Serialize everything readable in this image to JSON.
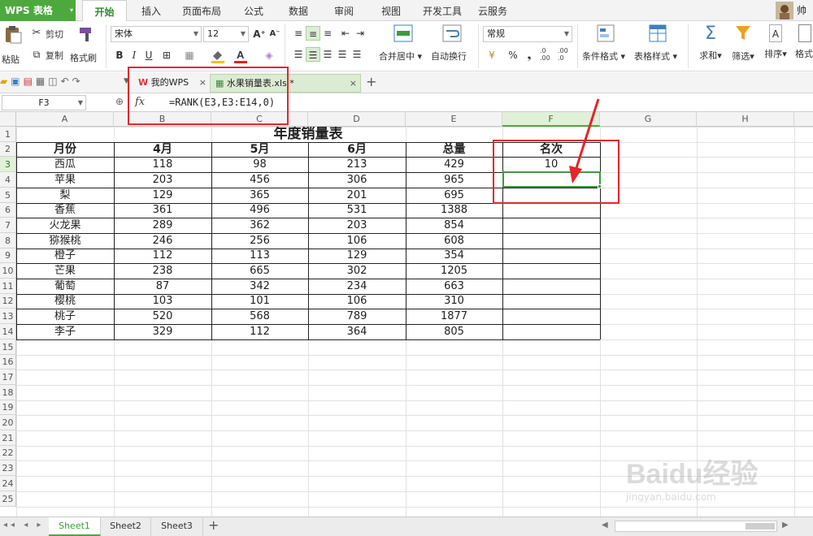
{
  "app": {
    "name": "WPS 表格",
    "caret": "▾"
  },
  "ribbon_tabs": [
    "开始",
    "插入",
    "页面布局",
    "公式",
    "数据",
    "审阅",
    "视图",
    "开发工具",
    "云服务"
  ],
  "user_label": "帅",
  "ribbon": {
    "paste": "粘贴",
    "cut": "剪切",
    "copy": "复制",
    "format_painter": "格式刷",
    "font_name": "宋体",
    "font_size": "12",
    "merge_center": "合并居中",
    "wrap_text": "自动换行",
    "number_format": "常规",
    "percent": "%",
    "comma": "❟",
    "inc_decimal": ".0\n.00",
    "dec_decimal": ".00\n.0",
    "conditional_format": "条件格式",
    "table_style": "表格样式",
    "sum": "求和",
    "filter": "筛选",
    "sort": "排序",
    "format": "格式"
  },
  "doc_tabs": [
    {
      "label": "我的WPS",
      "icon": "wps-logo-icon",
      "close": "×"
    },
    {
      "label": "水果销量表.xls *",
      "icon": "xls-file-icon",
      "close": "×"
    }
  ],
  "new_tab": "+",
  "formula_bar": {
    "cell_ref": "F3",
    "fx": "fx",
    "formula": "=RANK(E3,E3:E14,0)"
  },
  "columns": [
    "A",
    "B",
    "C",
    "D",
    "E",
    "F",
    "G",
    "H"
  ],
  "selected_col": "F",
  "selected_row": 3,
  "rows": [
    "1",
    "2",
    "3",
    "4",
    "5",
    "6",
    "7",
    "8",
    "9",
    "10",
    "11",
    "12",
    "13",
    "14",
    "15",
    "16",
    "17",
    "18",
    "19",
    "20",
    "21",
    "22",
    "23",
    "24",
    "25"
  ],
  "sheet": {
    "title": "年度销量表",
    "headers": [
      "月份",
      "4月",
      "5月",
      "6月",
      "总量",
      "名次"
    ],
    "data": [
      [
        "西瓜",
        "118",
        "98",
        "213",
        "429",
        "10"
      ],
      [
        "苹果",
        "203",
        "456",
        "306",
        "965",
        ""
      ],
      [
        "梨",
        "129",
        "365",
        "201",
        "695",
        ""
      ],
      [
        "香蕉",
        "361",
        "496",
        "531",
        "1388",
        ""
      ],
      [
        "火龙果",
        "289",
        "362",
        "203",
        "854",
        ""
      ],
      [
        "猕猴桃",
        "246",
        "256",
        "106",
        "608",
        ""
      ],
      [
        "橙子",
        "112",
        "113",
        "129",
        "354",
        ""
      ],
      [
        "芒果",
        "238",
        "665",
        "302",
        "1205",
        ""
      ],
      [
        "葡萄",
        "87",
        "342",
        "234",
        "663",
        ""
      ],
      [
        "樱桃",
        "103",
        "101",
        "106",
        "310",
        ""
      ],
      [
        "桃子",
        "520",
        "568",
        "789",
        "1877",
        ""
      ],
      [
        "李子",
        "329",
        "112",
        "364",
        "805",
        ""
      ]
    ]
  },
  "sheet_tabs": [
    "Sheet1",
    "Sheet2",
    "Sheet3"
  ],
  "active_sheet": "Sheet1",
  "add_sheet": "+",
  "watermark": {
    "brand": "Baidu经验",
    "url": "jingyan.baidu.com"
  },
  "colors": {
    "accent": "#4da83e",
    "annotation": "#e3262b"
  }
}
